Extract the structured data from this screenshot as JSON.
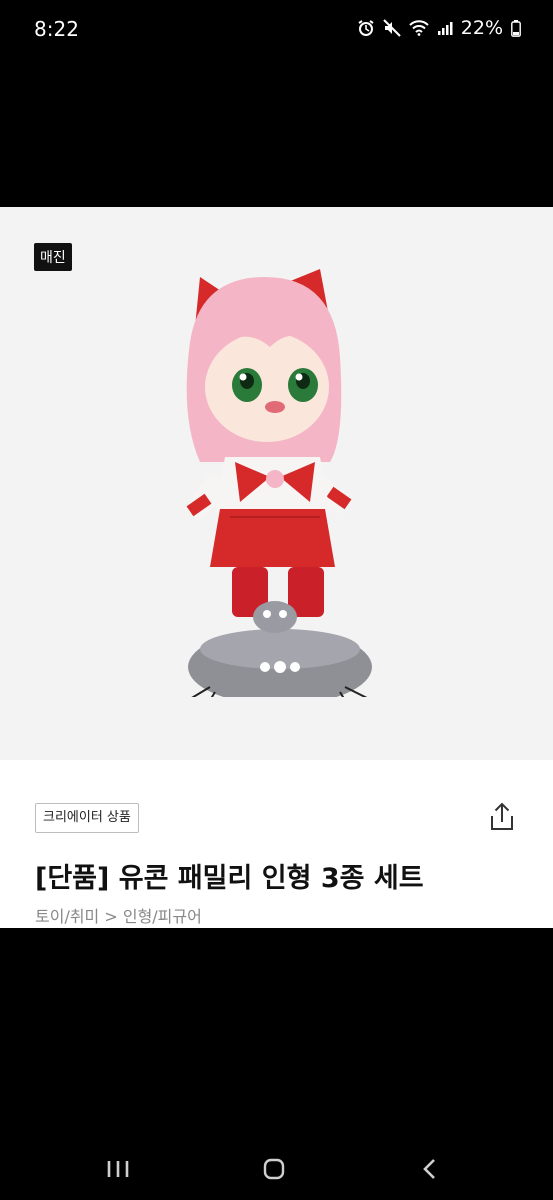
{
  "status_bar": {
    "time": "8:22",
    "battery_percent": "22%",
    "icons": [
      "alarm-icon",
      "mute-icon",
      "wifi-icon",
      "signal-icon",
      "battery-icon"
    ]
  },
  "product": {
    "soldout_badge": "매진",
    "creator_tag": "크리에이터 상품",
    "title": "[단품] 유콘 패밀리 인형 3종 세트",
    "breadcrumb": "토이/취미 > 인형/피규어",
    "image_alt": "plush-doll-image"
  },
  "nav_bar": {
    "icons": [
      "recent-apps-icon",
      "home-icon",
      "back-icon"
    ]
  },
  "colors": {
    "accent_red": "#d62a2a",
    "hair_pink": "#f4b6c6",
    "rock_gray": "#8f8f96"
  }
}
